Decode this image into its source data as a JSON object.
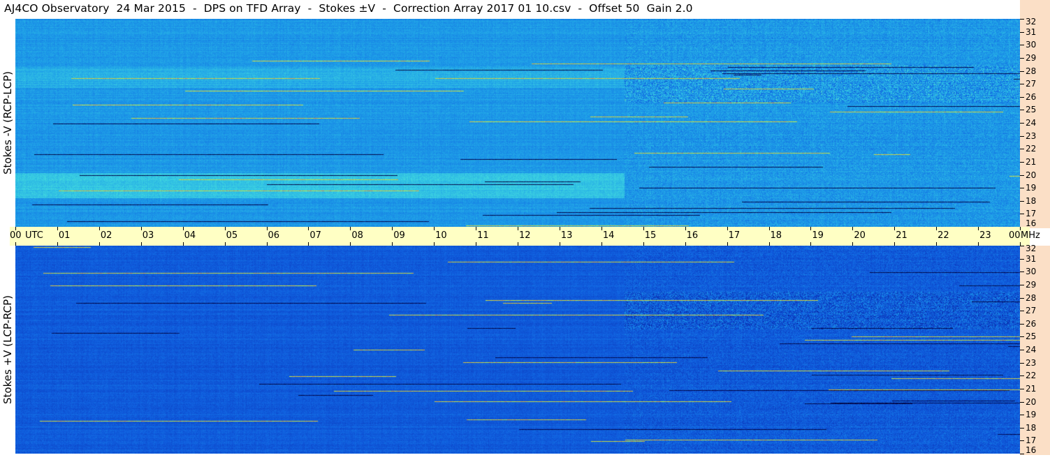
{
  "title": "AJ4CO Observatory  24 Mar 2015  -  DPS on TFD Array  -  Stokes ±V  -  Correction Array 2017 01 10.csv  -  Offset 50  Gain 2.0",
  "chart_data": [
    {
      "type": "heatmap",
      "panel": "top",
      "ylabel": "Stokes -V (RCP-LCP)",
      "xlabel": "UTC",
      "x_unit": "UTC",
      "y_unit": "MHz",
      "x_range": [
        0,
        24
      ],
      "y_range": [
        16,
        32
      ],
      "x_ticks": [
        "00",
        "01",
        "02",
        "03",
        "04",
        "05",
        "06",
        "07",
        "08",
        "09",
        "10",
        "11",
        "12",
        "13",
        "14",
        "15",
        "16",
        "17",
        "18",
        "19",
        "20",
        "21",
        "22",
        "23",
        "00"
      ],
      "y_ticks": [
        "16",
        "17",
        "18",
        "19",
        "20",
        "21",
        "22",
        "23",
        "24",
        "25",
        "26",
        "27",
        "28",
        "29",
        "30",
        "31",
        "32"
      ],
      "colormap": [
        "#000033",
        "#0a2fb3",
        "#1060e0",
        "#1e9fe8",
        "#3fd8e0",
        "#c8f040",
        "#ff5a40"
      ],
      "dominant_color": "#1f8fe6"
    },
    {
      "type": "heatmap",
      "panel": "bottom",
      "ylabel": "Stokes +V (LCP-RCP)",
      "xlabel": "UTC",
      "x_unit": "UTC",
      "y_unit": "MHz",
      "x_range": [
        0,
        24
      ],
      "y_range": [
        16,
        32
      ],
      "x_ticks": [
        "00",
        "01",
        "02",
        "03",
        "04",
        "05",
        "06",
        "07",
        "08",
        "09",
        "10",
        "11",
        "12",
        "13",
        "14",
        "15",
        "16",
        "17",
        "18",
        "19",
        "20",
        "21",
        "22",
        "23",
        "00"
      ],
      "y_ticks": [
        "16",
        "17",
        "18",
        "19",
        "20",
        "21",
        "22",
        "23",
        "24",
        "25",
        "26",
        "27",
        "28",
        "29",
        "30",
        "31",
        "32"
      ],
      "colormap": [
        "#000033",
        "#0a2fb3",
        "#1060e0",
        "#1e9fe8",
        "#3fd8e0",
        "#c8f040",
        "#ff5a40"
      ],
      "dominant_color": "#1548d0"
    }
  ],
  "colors": {
    "time_axis_bg": "#ffffc4",
    "freq_axis_bg": "#fbdfc6"
  }
}
